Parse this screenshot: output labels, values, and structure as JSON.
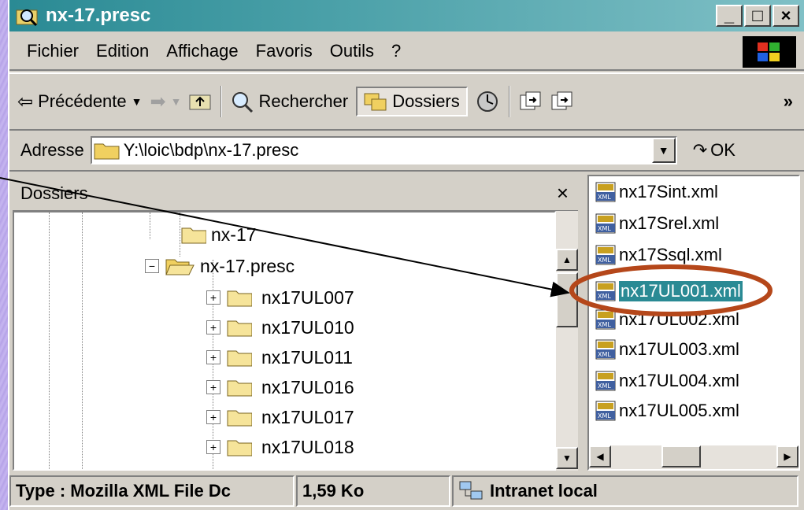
{
  "window": {
    "title": "nx-17.presc",
    "controls": [
      "_",
      "□",
      "×"
    ]
  },
  "menubar": {
    "items": [
      "Fichier",
      "Edition",
      "Affichage",
      "Favoris",
      "Outils",
      "?"
    ]
  },
  "toolbar": {
    "back_label": "Précédente",
    "search_label": "Rechercher",
    "folders_label": "Dossiers",
    "more_glyph": "»"
  },
  "address": {
    "label": "Adresse",
    "value": "Y:\\loic\\bdp\\nx-17.presc",
    "go_label": "OK"
  },
  "folders_pane": {
    "header": "Dossiers",
    "close": "×",
    "tree": [
      {
        "label": "nx-17",
        "expander": ""
      },
      {
        "label": "nx-17.presc",
        "expander": "−",
        "open": true
      },
      {
        "label": "nx17UL007",
        "expander": "+"
      },
      {
        "label": "nx17UL010",
        "expander": "+"
      },
      {
        "label": "nx17UL011",
        "expander": "+"
      },
      {
        "label": "nx17UL016",
        "expander": "+"
      },
      {
        "label": "nx17UL017",
        "expander": "+"
      },
      {
        "label": "nx17UL018",
        "expander": "+"
      }
    ]
  },
  "files_pane": {
    "files": [
      {
        "name": "nx17Sint.xml",
        "selected": false
      },
      {
        "name": "nx17Srel.xml",
        "selected": false
      },
      {
        "name": "nx17Ssql.xml",
        "selected": false
      },
      {
        "name": "nx17UL001.xml",
        "selected": true
      },
      {
        "name": "nx17UL002.xml",
        "selected": false
      },
      {
        "name": "nx17UL003.xml",
        "selected": false
      },
      {
        "name": "nx17UL004.xml",
        "selected": false
      },
      {
        "name": "nx17UL005.xml",
        "selected": false
      }
    ]
  },
  "statusbar": {
    "type": "Type : Mozilla XML File Dc",
    "size": "1,59 Ko",
    "zone": "Intranet local"
  },
  "colors": {
    "title_start": "#2a8a94",
    "selection": "#2a8a94",
    "highlight_ellipse": "#b5471a",
    "background": "#bcaaea"
  }
}
